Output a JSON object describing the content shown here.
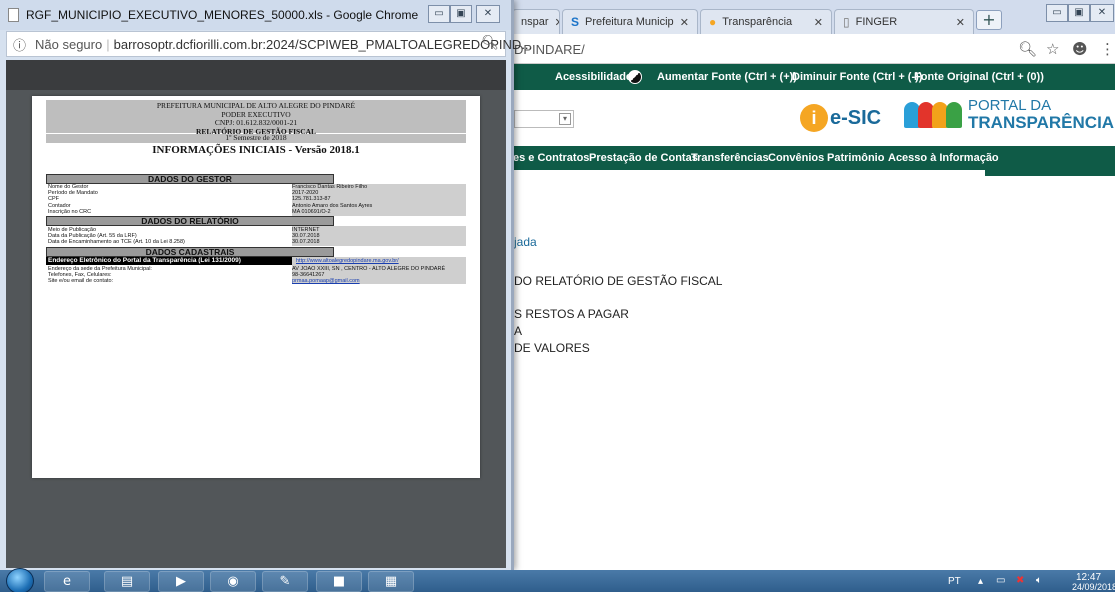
{
  "background_browser": {
    "tabs": [
      {
        "label": "nspar",
        "icon": ""
      },
      {
        "label": "Prefeitura Municip",
        "icon": "S"
      },
      {
        "label": "Transparência",
        "icon": "●"
      },
      {
        "label": "FINGER",
        "icon": "▯"
      }
    ],
    "tab_close": "✕",
    "new_tab": "+",
    "url_fragment": "DPINDARE/",
    "accessibility_bar": {
      "label": "Acessibilidade:",
      "increase": "Aumentar Fonte (Ctrl + (+))",
      "decrease": "Diminuir Fonte (Ctrl + (-))",
      "reset": "Fonte Original (Ctrl + (0))"
    },
    "esic_logo": "e-SIC",
    "portal_logo": {
      "line1": "PORTAL DA",
      "line2": "TRANSPARÊNCIA"
    },
    "nav_items": [
      "es e Contratos",
      "Prestação de Contas",
      "Transferências",
      "Convênios",
      "Patrimônio",
      "Acesso à Informação"
    ],
    "page_lines": [
      "jada",
      "DO RELATÓRIO DE GESTÃO FISCAL",
      "S RESTOS A PAGAR",
      "A",
      "DE VALORES"
    ]
  },
  "xls_window": {
    "title": "RGF_MUNICIPIO_EXECUTIVO_MENORES_50000.xls - Google Chrome",
    "url_prefix": "Não seguro",
    "url": "barrosoptr.dcfiorilli.com.br:2024/SCPIWEB_PMALTOALEGREDOPIND...",
    "report": {
      "header_lines": [
        "PREFEITURA MUNICIPAL DE ALTO ALEGRE DO PINDARÉ",
        "PODER EXECUTIVO",
        "CNPJ: 01.612.832/0001-21"
      ],
      "report_name": "RELATÓRIO DE GESTÃO FISCAL",
      "period": "1º Semestre de 2018",
      "title": "INFORMAÇÕES INICIAIS - Versão 2018.1",
      "section_gestor": "DADOS DO GESTOR",
      "gestor_rows": [
        {
          "k": "Nome do Gestor",
          "v": "Francisco Dantas Ribeiro Filho"
        },
        {
          "k": "Período de Mandato",
          "v": "2017-2020"
        },
        {
          "k": "CPF",
          "v": "125.781.313-87"
        },
        {
          "k": "Contador",
          "v": "Antonio Amaro dos Santos Ayres"
        },
        {
          "k": "Inscrição no CRC",
          "v": "MA 010691/O-2"
        }
      ],
      "section_relatorio": "DADOS DO RELATÓRIO",
      "relatorio_rows": [
        {
          "k": "Meio de Publicação",
          "v": "INTERNET"
        },
        {
          "k": "Data da Publicação (Art. 55 da LRF)",
          "v": "30.07.2018"
        },
        {
          "k": "Data de Encaminhamento ao TCE (Art. 10 da Lei 8.258)",
          "v": "30.07.2018"
        }
      ],
      "section_cadastrais": "DADOS CADASTRAIS",
      "portal_row": {
        "k": "Endereço Eletrônico do Portal da Transparência (Lei 131/2009)",
        "v": "http://www.altoalegredopindare.ma.gov.br/"
      },
      "cadastrais_rows": [
        {
          "k": "Endereço da sede da Prefeitura Municipal:",
          "v": "AV JOAO XXIII, SN , CENTRO - ALTO ALEGRE DO PINDARÉ"
        },
        {
          "k": "Telefones, Fax, Celulares:",
          "v": "98-36641267"
        },
        {
          "k": "Site e/ou email de contato:",
          "v": "prmaa.pomaap@gmail.com"
        }
      ]
    }
  },
  "taskbar": {
    "lang": "PT",
    "time": "12:47",
    "date": "24/09/2018"
  }
}
